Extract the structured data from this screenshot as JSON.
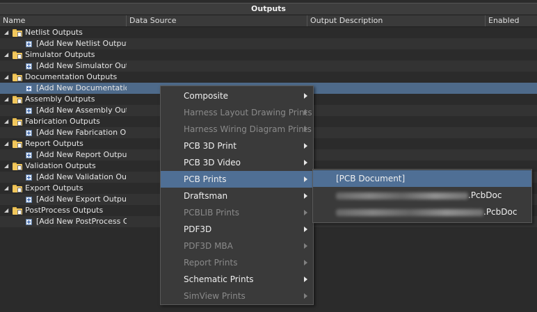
{
  "panel": {
    "title": "Outputs"
  },
  "columns": {
    "name": "Name",
    "data_source": "Data Source",
    "output_description": "Output Description",
    "enabled": "Enabled"
  },
  "groups": [
    {
      "label": "Netlist Outputs",
      "add_label": "[Add New Netlist Output]"
    },
    {
      "label": "Simulator Outputs",
      "add_label": "[Add New Simulator Outp"
    },
    {
      "label": "Documentation Outputs",
      "add_label": "[Add New Documentation"
    },
    {
      "label": "Assembly Outputs",
      "add_label": "[Add New Assembly Outp"
    },
    {
      "label": "Fabrication Outputs",
      "add_label": "[Add New Fabrication Ou"
    },
    {
      "label": "Report Outputs",
      "add_label": "[Add New Report Output"
    },
    {
      "label": "Validation Outputs",
      "add_label": "[Add New Validation Out"
    },
    {
      "label": "Export Outputs",
      "add_label": "[Add New Export Output]"
    },
    {
      "label": "PostProcess Outputs",
      "add_label": "[Add New PostProcess Ou"
    }
  ],
  "context_menu": [
    {
      "label": "Composite",
      "disabled": false
    },
    {
      "label": "Harness Layout Drawing Prints",
      "disabled": true
    },
    {
      "label": "Harness Wiring Diagram Prints",
      "disabled": true
    },
    {
      "label": "PCB 3D Print",
      "disabled": false
    },
    {
      "label": "PCB 3D Video",
      "disabled": false
    },
    {
      "label": "PCB Prints",
      "disabled": false,
      "highlighted": true
    },
    {
      "label": "Draftsman",
      "disabled": false
    },
    {
      "label": "PCBLIB Prints",
      "disabled": true
    },
    {
      "label": "PDF3D",
      "disabled": false
    },
    {
      "label": "PDF3D MBA",
      "disabled": true
    },
    {
      "label": "Report Prints",
      "disabled": true
    },
    {
      "label": "Schematic Prints",
      "disabled": false
    },
    {
      "label": "SimView Prints",
      "disabled": true
    }
  ],
  "submenu": [
    {
      "label": "[PCB Document]"
    },
    {
      "label": ".PcbDoc"
    },
    {
      "label": ".PcbDoc"
    }
  ],
  "colors": {
    "selection": "#4e6a8a",
    "menu_highlight": "#4f6f95",
    "background": "#2b2b2b"
  }
}
